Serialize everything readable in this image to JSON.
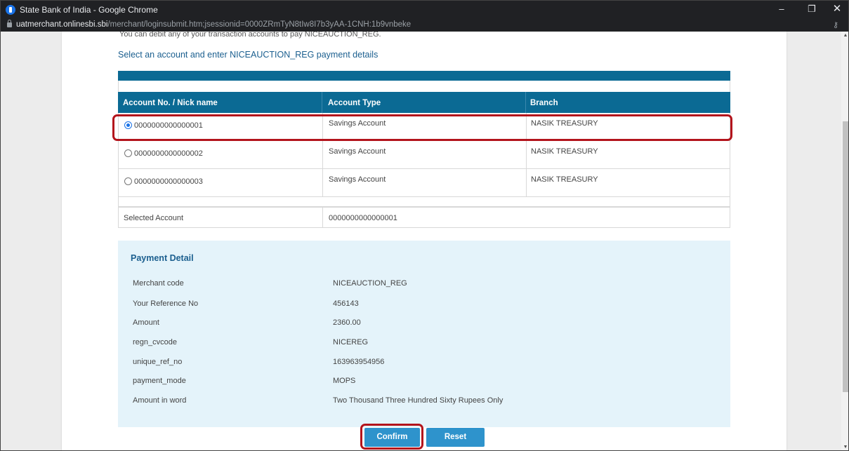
{
  "browser": {
    "window_title": "State Bank of India - Google Chrome",
    "url_host": "uatmerchant.onlinesbi.sbi",
    "url_path": "/merchant/loginsubmit.htm;jsessionid=0000ZRmTyN8tIw8I7b3yAA-1CNH:1b9vnbeke",
    "minimize_glyph": "–",
    "maximize_glyph": "❐",
    "close_glyph": "✕",
    "key_glyph": "⚷"
  },
  "page": {
    "partial_text": "You can debit any of your transaction accounts to pay NICEAUCTION_REG.",
    "instruction": "Select an account and enter NICEAUCTION_REG payment details",
    "accounts_table": {
      "headers": [
        "Account No. / Nick name",
        "Account Type",
        "Branch"
      ],
      "rows": [
        {
          "account": "0000000000000001",
          "type": "Savings Account",
          "branch": "NASIK TREASURY",
          "selected": true
        },
        {
          "account": "0000000000000002",
          "type": "Savings Account",
          "branch": "NASIK TREASURY",
          "selected": false
        },
        {
          "account": "0000000000000003",
          "type": "Savings Account",
          "branch": "NASIK TREASURY",
          "selected": false
        }
      ],
      "selected_label": "Selected Account",
      "selected_value": "0000000000000001"
    },
    "payment_detail": {
      "title": "Payment Detail",
      "rows": [
        {
          "key": "Merchant code",
          "value": "NICEAUCTION_REG"
        },
        {
          "key": "Your Reference No",
          "value": "456143"
        },
        {
          "key": "Amount",
          "value": "2360.00"
        },
        {
          "key": "regn_cvcode",
          "value": "NICEREG"
        },
        {
          "key": "unique_ref_no",
          "value": "163963954956"
        },
        {
          "key": "payment_mode",
          "value": "MOPS"
        },
        {
          "key": "Amount in word",
          "value": "Two Thousand Three Hundred Sixty Rupees Only"
        }
      ]
    },
    "buttons": {
      "confirm": "Confirm",
      "reset": "Reset"
    }
  },
  "colors": {
    "header_band": "#0b6a94",
    "payment_bg": "#e4f3fa",
    "button": "#2e93cc",
    "highlight": "#b3141c",
    "link_text": "#1b5f8f"
  }
}
